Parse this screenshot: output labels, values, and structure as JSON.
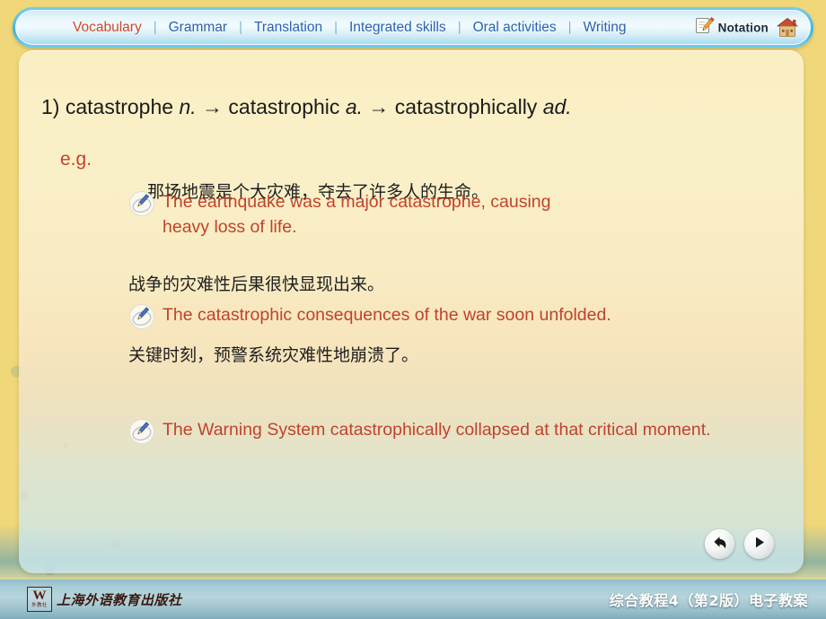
{
  "nav": {
    "items": [
      {
        "label": "Vocabulary",
        "active": true
      },
      {
        "label": "Grammar",
        "active": false
      },
      {
        "label": "Translation",
        "active": false
      },
      {
        "label": "Integrated skills",
        "active": false
      },
      {
        "label": "Oral activities",
        "active": false
      },
      {
        "label": "Writing",
        "active": false
      }
    ],
    "separator": "|",
    "notation_label": "Notation",
    "notation_icon": "pencil-notepad-icon",
    "home_icon": "house-icon",
    "active_color": "#d0452b",
    "link_color": "#2a62b0"
  },
  "content": {
    "headword": {
      "number": "1)",
      "base_word": "catastrophe",
      "base_pos": "n.",
      "arrow": "→",
      "derived_word": "catastrophic",
      "derived_pos": "a.",
      "arrow2": "→",
      "adverb_word": "catastrophically",
      "adverb_pos": "ad."
    },
    "eg_label": "e.g.",
    "examples": [
      {
        "cn": "那场地震是个大灾难，夺去了许多人的生命。",
        "en": "The earthquake was a major catastrophe, causing heavy loss of life.",
        "icon": "pencil-icon"
      },
      {
        "cn": "战争的灾难性后果很快显现出来。",
        "en": "The catastrophic consequences of the war soon unfolded.",
        "icon": "pencil-icon"
      },
      {
        "cn": "关键时刻，预警系统灾难性地崩溃了。",
        "en": "The Warning System catastrophically collapsed at that critical moment.",
        "icon": "pencil-icon"
      }
    ],
    "english_color": "#c0432c",
    "chinese_color": "#1e1e1e"
  },
  "controls": {
    "back_icon": "back-arrow-icon",
    "next_icon": "play-forward-icon"
  },
  "footer": {
    "logo_mark": "W",
    "logo_mark_sub": "外教社",
    "logo_text": "上海外语教育出版社",
    "title": "综合教程4（第2版）电子教案"
  }
}
